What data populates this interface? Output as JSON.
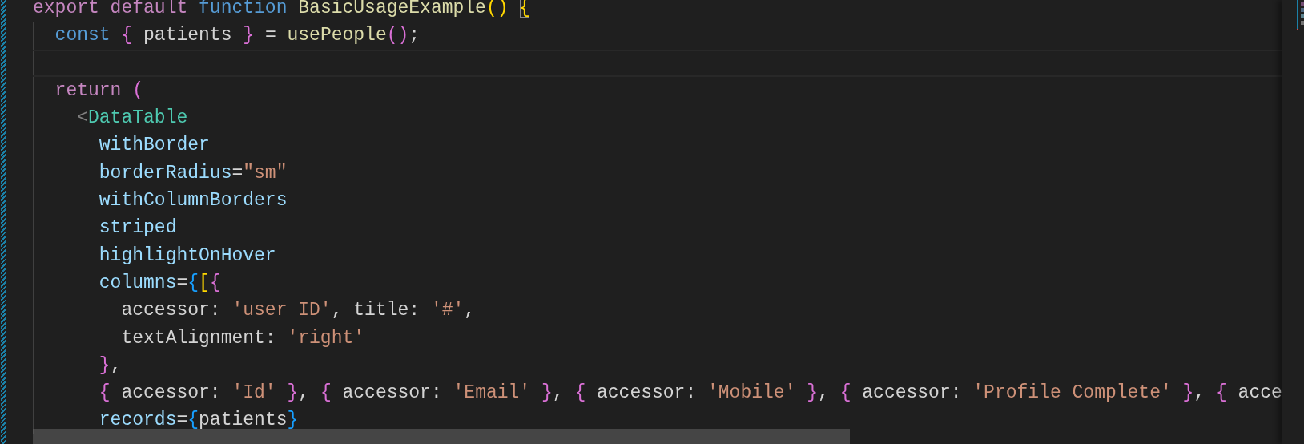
{
  "editor": {
    "lines": [
      {
        "tokens": [
          {
            "kind": "keyword",
            "text": "export default "
          },
          {
            "kind": "storage",
            "text": "function "
          },
          {
            "kind": "function",
            "text": "BasicUsageExample"
          },
          {
            "kind": "bracket1",
            "text": "() "
          },
          {
            "kind": "bracket1",
            "text": "{",
            "boxed": true
          }
        ],
        "current": false
      },
      {
        "tokens": [
          {
            "kind": "storage",
            "text": "  const "
          },
          {
            "kind": "bracket2",
            "text": "{"
          },
          {
            "kind": "plain",
            "text": " patients "
          },
          {
            "kind": "bracket2",
            "text": "}"
          },
          {
            "kind": "plain",
            "text": " = "
          },
          {
            "kind": "function",
            "text": "usePeople"
          },
          {
            "kind": "bracket2",
            "text": "()"
          },
          {
            "kind": "plain",
            "text": ";"
          }
        ],
        "current": false
      },
      {
        "current": true
      },
      {
        "tokens": [
          {
            "kind": "keyword",
            "text": "  return "
          },
          {
            "kind": "bracket2",
            "text": "("
          }
        ],
        "current": false
      },
      {
        "tokens": [
          {
            "kind": "punct",
            "text": "    <"
          },
          {
            "kind": "tag",
            "text": "DataTable"
          }
        ],
        "current": false
      },
      {
        "tokens": [
          {
            "kind": "attr",
            "text": "      withBorder"
          }
        ],
        "current": false
      },
      {
        "tokens": [
          {
            "kind": "attr",
            "text": "      borderRadius"
          },
          {
            "kind": "plain",
            "text": "="
          },
          {
            "kind": "string",
            "text": "\"sm\""
          }
        ],
        "current": false
      },
      {
        "tokens": [
          {
            "kind": "attr",
            "text": "      withColumnBorders"
          }
        ],
        "current": false
      },
      {
        "tokens": [
          {
            "kind": "attr",
            "text": "      striped"
          }
        ],
        "current": false
      },
      {
        "tokens": [
          {
            "kind": "attr",
            "text": "      highlightOnHover"
          }
        ],
        "current": false
      },
      {
        "tokens": [
          {
            "kind": "attr",
            "text": "      columns"
          },
          {
            "kind": "plain",
            "text": "="
          },
          {
            "kind": "bracket3",
            "text": "{"
          },
          {
            "kind": "bracket1",
            "text": "["
          },
          {
            "kind": "bracket2",
            "text": "{"
          }
        ],
        "current": false
      },
      {
        "tokens": [
          {
            "kind": "plain",
            "text": "        accessor: "
          },
          {
            "kind": "string",
            "text": "'user ID'"
          },
          {
            "kind": "plain",
            "text": ", title: "
          },
          {
            "kind": "string",
            "text": "'#'"
          },
          {
            "kind": "plain",
            "text": ","
          }
        ],
        "current": false
      },
      {
        "tokens": [
          {
            "kind": "plain",
            "text": "        textAlignment: "
          },
          {
            "kind": "string",
            "text": "'right'"
          }
        ],
        "current": false
      },
      {
        "tokens": [
          {
            "kind": "bracket2",
            "text": "      }"
          },
          {
            "kind": "plain",
            "text": ","
          }
        ],
        "current": false
      },
      {
        "tokens": [
          {
            "kind": "bracket2",
            "text": "      {"
          },
          {
            "kind": "plain",
            "text": " accessor: "
          },
          {
            "kind": "string",
            "text": "'Id' "
          },
          {
            "kind": "bracket2",
            "text": "}"
          },
          {
            "kind": "plain",
            "text": ", "
          },
          {
            "kind": "bracket2",
            "text": "{"
          },
          {
            "kind": "plain",
            "text": " accessor: "
          },
          {
            "kind": "string",
            "text": "'Email' "
          },
          {
            "kind": "bracket2",
            "text": "}"
          },
          {
            "kind": "plain",
            "text": ", "
          },
          {
            "kind": "bracket2",
            "text": "{"
          },
          {
            "kind": "plain",
            "text": " accessor: "
          },
          {
            "kind": "string",
            "text": "'Mobile' "
          },
          {
            "kind": "bracket2",
            "text": "}"
          },
          {
            "kind": "plain",
            "text": ", "
          },
          {
            "kind": "bracket2",
            "text": "{"
          },
          {
            "kind": "plain",
            "text": " accessor: "
          },
          {
            "kind": "string",
            "text": "'Profile Complete' "
          },
          {
            "kind": "bracket2",
            "text": "}"
          },
          {
            "kind": "plain",
            "text": ", "
          },
          {
            "kind": "bracket2",
            "text": "{"
          },
          {
            "kind": "plain",
            "text": " acce"
          }
        ],
        "current": false
      },
      {
        "tokens": [
          {
            "kind": "attr",
            "text": "      records"
          },
          {
            "kind": "plain",
            "text": "="
          },
          {
            "kind": "bracket3",
            "text": "{"
          },
          {
            "kind": "plain",
            "text": "patients"
          },
          {
            "kind": "bracket3",
            "text": "}"
          }
        ],
        "current": false
      }
    ]
  }
}
